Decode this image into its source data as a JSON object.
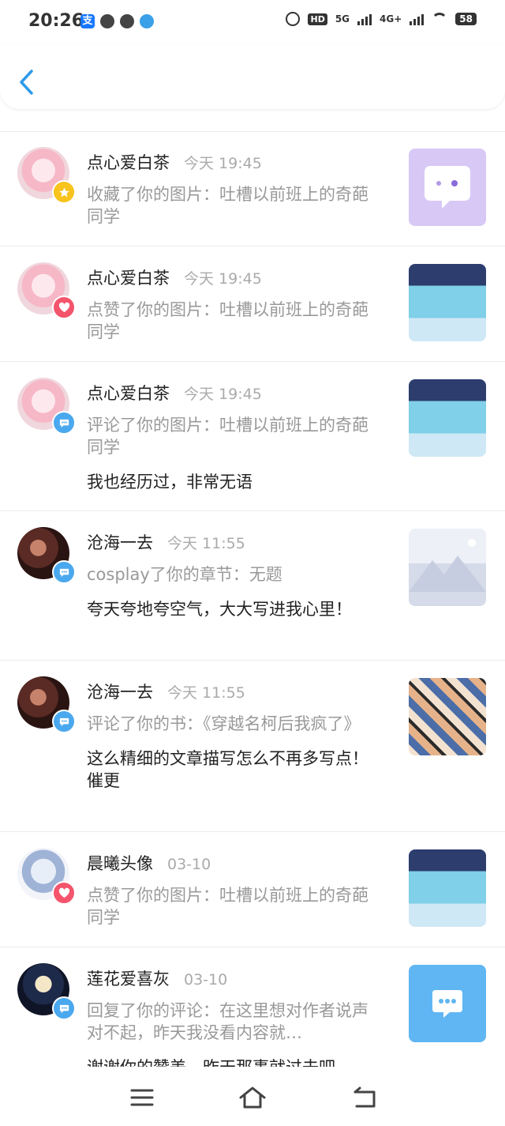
{
  "status_bar": {
    "time": "20:26",
    "left_icons": [
      "alipay-icon",
      "link-icon",
      "cloud-icon",
      "qq-browser-icon"
    ],
    "hd_label": "HD",
    "network_5g": "5G",
    "network_4g": "4G+",
    "battery": "58"
  },
  "header": {
    "back_icon": "chevron-left-icon"
  },
  "notifications": [
    {
      "name": "点心爱白茶",
      "time": "今天 19:45",
      "action": "收藏了你的图片：吐槽以前班上的奇葩同学",
      "reply": "",
      "badge": "star",
      "avatar": "pink",
      "thumb": "purple-chat"
    },
    {
      "name": "点心爱白茶",
      "time": "今天 19:45",
      "action": "点赞了你的图片：吐槽以前班上的奇葩同学",
      "reply": "",
      "badge": "heart",
      "avatar": "pink",
      "thumb": "anime"
    },
    {
      "name": "点心爱白茶",
      "time": "今天 19:45",
      "action": "评论了你的图片：吐槽以前班上的奇葩同学",
      "reply": "我也经历过，非常无语",
      "badge": "comment",
      "avatar": "pink",
      "thumb": "anime"
    },
    {
      "name": "沧海一去",
      "time": "今天 11:55",
      "action": "cosplay了你的章节：无题",
      "reply": "夸天夸地夸空气，大大写进我心里！",
      "badge": "comment",
      "avatar": "dark",
      "thumb": "mountain"
    },
    {
      "name": "沧海一去",
      "time": "今天 11:55",
      "action": "评论了你的书：《穿越名柯后我疯了》",
      "reply": "这么精细的文章描写怎么不再多写点！催更",
      "badge": "comment",
      "avatar": "dark",
      "thumb": "manga"
    },
    {
      "name": "晨曦头像",
      "time": "03-10",
      "action": "点赞了你的图片：吐槽以前班上的奇葩同学",
      "reply": "",
      "badge": "heart",
      "avatar": "white",
      "thumb": "anime"
    },
    {
      "name": "莲花爱喜灰",
      "time": "03-10",
      "action": "回复了你的评论：在这里想对作者说声对不起，昨天我没看内容就…",
      "reply": "谢谢你的赞美，昨天那事就过去吧",
      "badge": "comment",
      "avatar": "night",
      "thumb": "blue-chat"
    }
  ],
  "nav_bar": {
    "icons": [
      "menu-icon",
      "home-icon",
      "back-icon"
    ]
  },
  "colors": {
    "accent": "#2f9be8",
    "star": "#f8c31c",
    "heart": "#f4546c",
    "comment": "#4aa8ee",
    "muted": "#999999"
  }
}
